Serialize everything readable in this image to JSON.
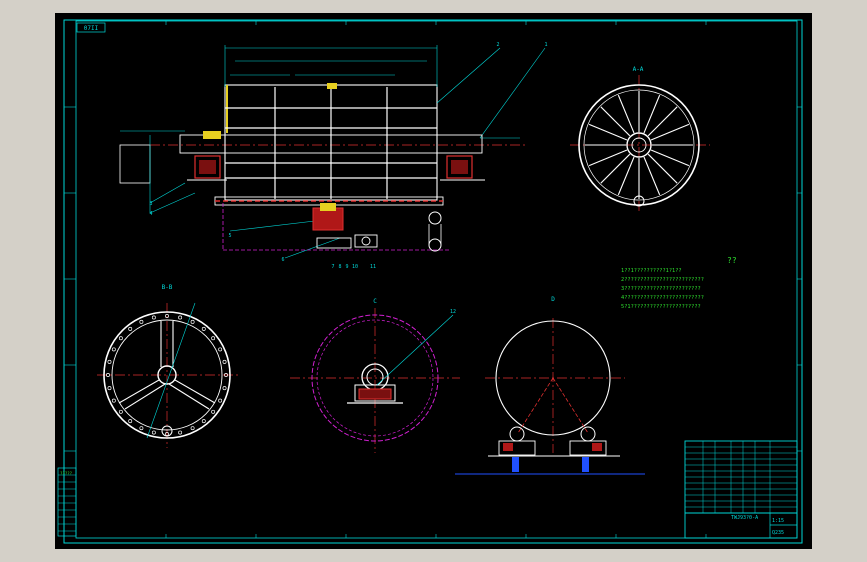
{
  "drawing": {
    "top_left_tag": "07II",
    "top_right_code": "?",
    "view_labels": {
      "end_view": "A-A",
      "sec_b": "B-B",
      "sec_c": "C",
      "sec_d": "D"
    },
    "balloons": [
      "1",
      "2",
      "3",
      "4",
      "5",
      "6",
      "7",
      "8",
      "9",
      "10",
      "11",
      "12"
    ],
    "notes_title": "??",
    "notes": [
      "1??1??????????1?1??",
      "2?????????????????????????",
      "3????????????????????????",
      "4?????????????????????????",
      "5?1??????????????????????"
    ],
    "title_block": {
      "drawing_number": "TWJ93?0-A",
      "scale": "1:15",
      "material": "Q235"
    },
    "revision_table_label": "?????"
  },
  "colors": {
    "paper": "#000000",
    "frame": "#00d8d8",
    "outline": "#ffffff",
    "centerline": "#e03030",
    "hidden": "#d020d0",
    "annotation": "#2ee02e",
    "dimension": "#00d8d8",
    "accent_yellow": "#e8d020",
    "accent_blue": "#2050ff"
  }
}
